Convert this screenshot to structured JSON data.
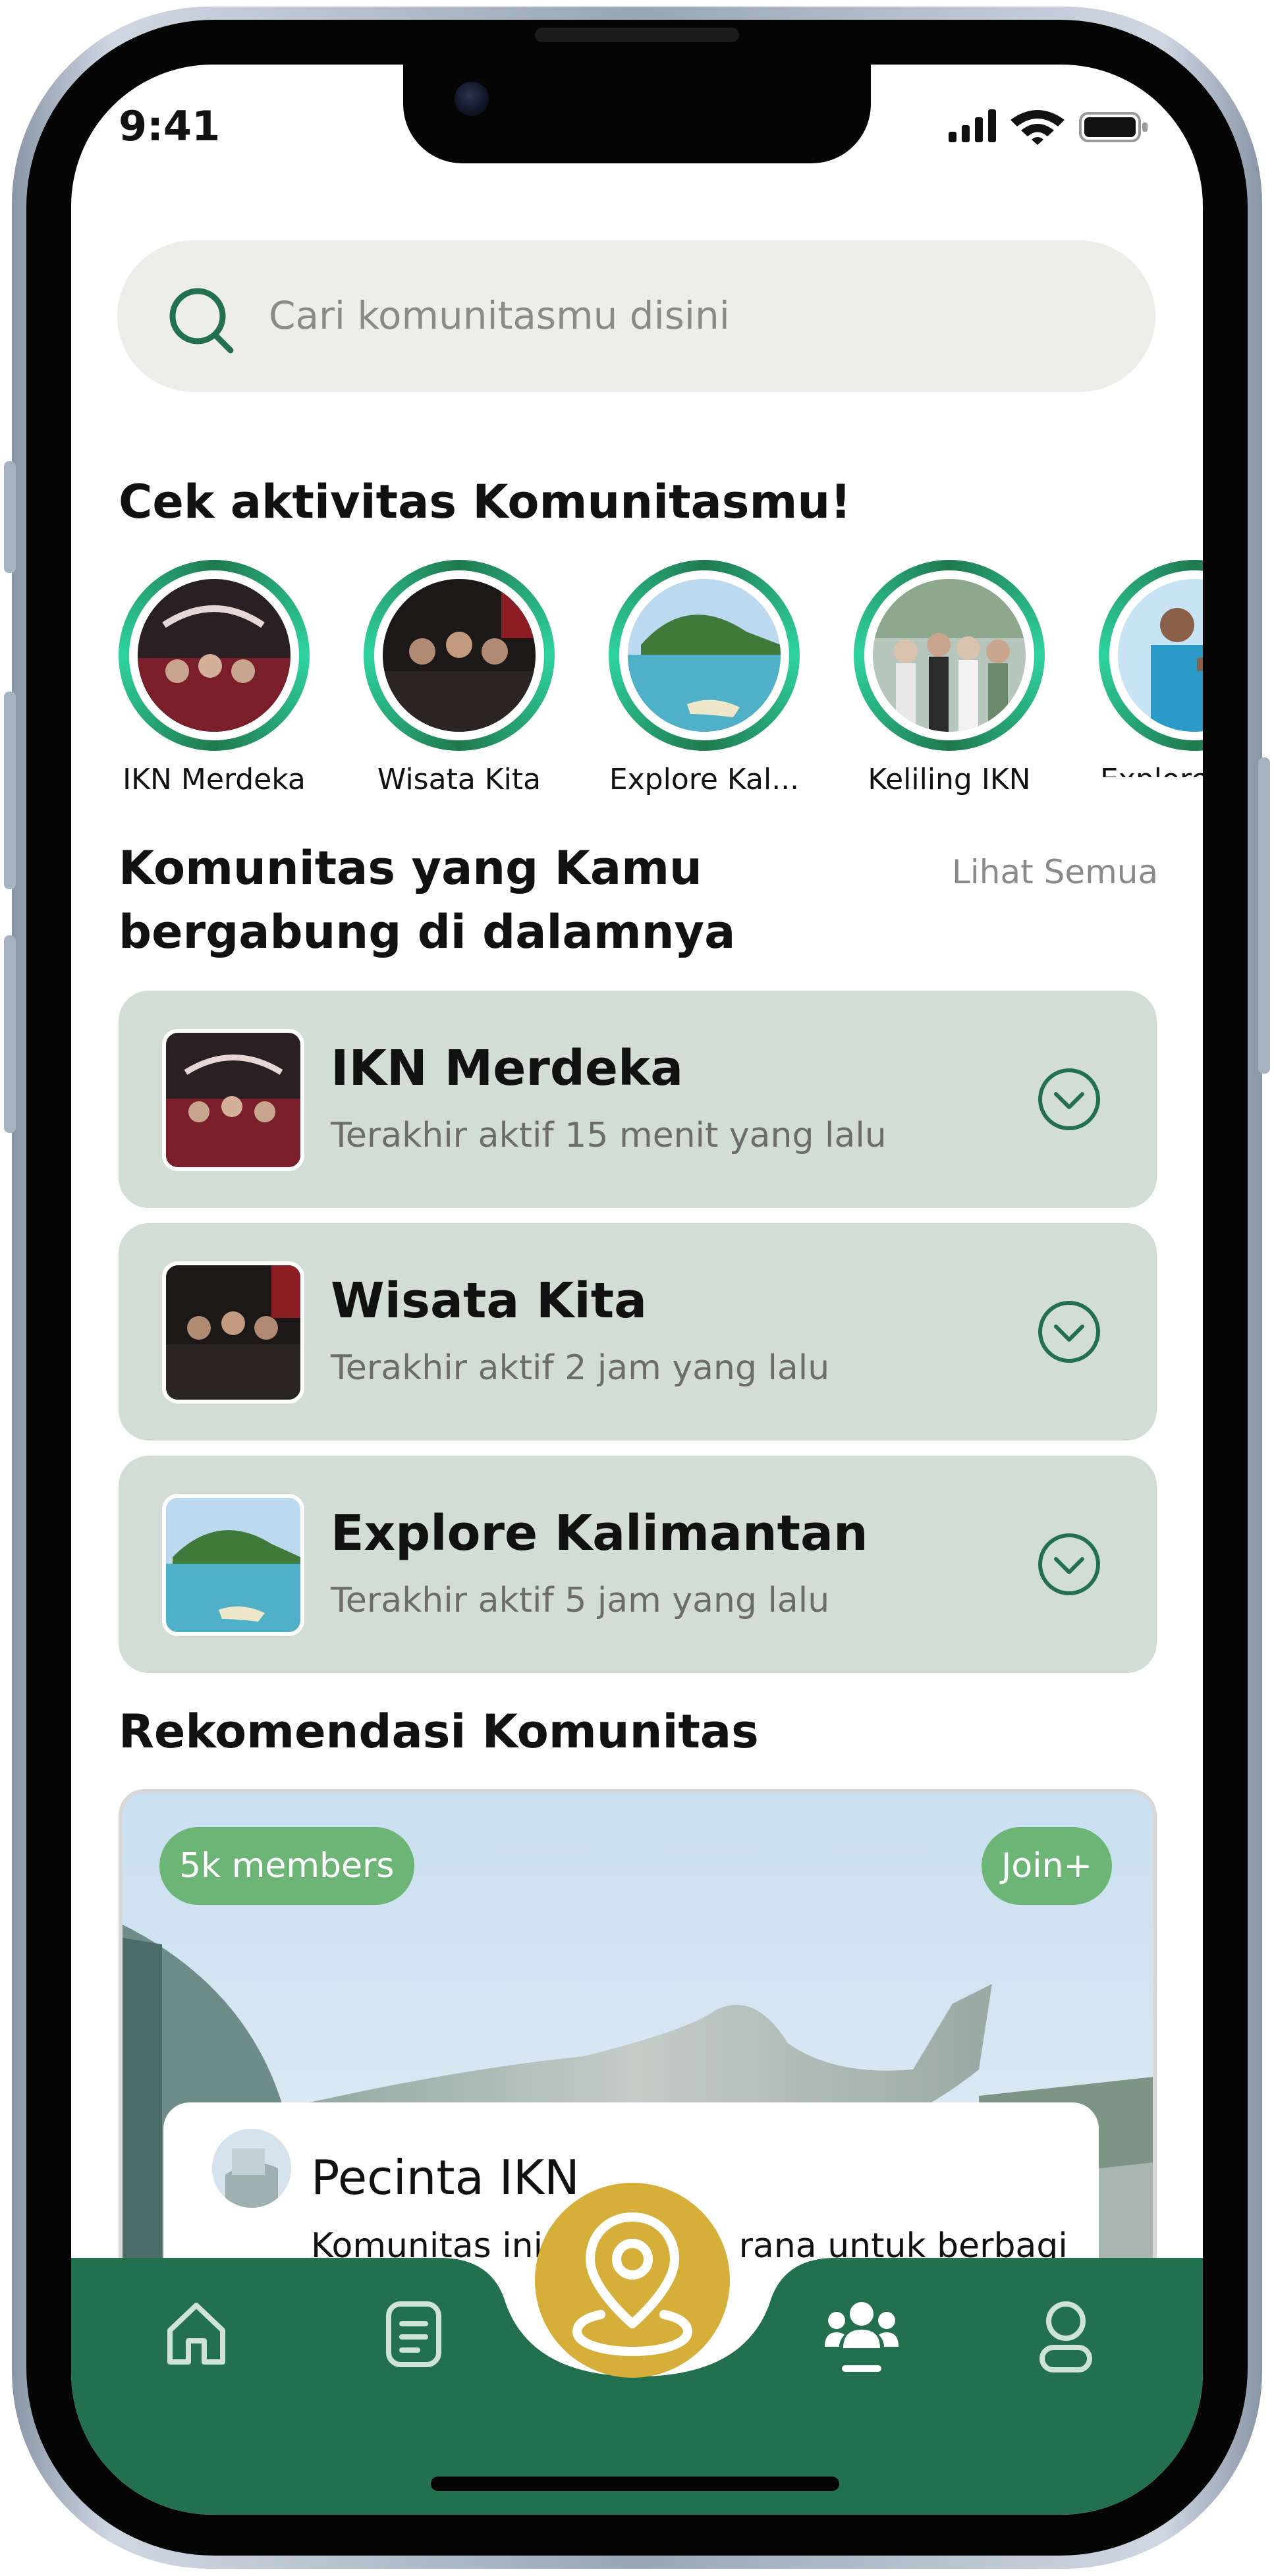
{
  "status_bar": {
    "time": "9:41"
  },
  "search": {
    "placeholder": "Cari komunitasmu disini"
  },
  "stories": {
    "heading": "Cek aktivitas Komunitasmu!",
    "items": [
      {
        "label": "IKN Merdeka"
      },
      {
        "label": "Wisata Kita"
      },
      {
        "label": "Explore Kal..."
      },
      {
        "label": "Keliling IKN"
      },
      {
        "label": "Explore"
      }
    ]
  },
  "joined": {
    "heading": "Komunitas yang Kamu bergabung di dalamnya",
    "see_all": "Lihat Semua",
    "items": [
      {
        "name": "IKN Merdeka",
        "last_active": "Terakhir aktif 15 menit yang lalu"
      },
      {
        "name": "Wisata Kita",
        "last_active": "Terakhir aktif 2 jam yang lalu"
      },
      {
        "name": "Explore Kalimantan",
        "last_active": "Terakhir aktif 5 jam yang lalu"
      }
    ]
  },
  "recommendation": {
    "heading": "Rekomendasi Komunitas",
    "members_badge": "5k members",
    "join_label": "Join+",
    "title": "Pecinta IKN",
    "description": "Komunitas ini                  rana untuk berbagi"
  },
  "colors": {
    "primary_green": "#23704f",
    "card_bg": "#d2ddd5",
    "fab_gold": "#d5af3a",
    "badge_green": "#6cb576",
    "story_ring": "#2fd3a0"
  },
  "bottom_nav": {
    "items": [
      {
        "icon": "home-icon",
        "active": false
      },
      {
        "icon": "document-icon",
        "active": false
      },
      {
        "icon": "map-pin-icon",
        "active": false
      },
      {
        "icon": "community-icon",
        "active": true
      },
      {
        "icon": "profile-icon",
        "active": false
      }
    ]
  }
}
